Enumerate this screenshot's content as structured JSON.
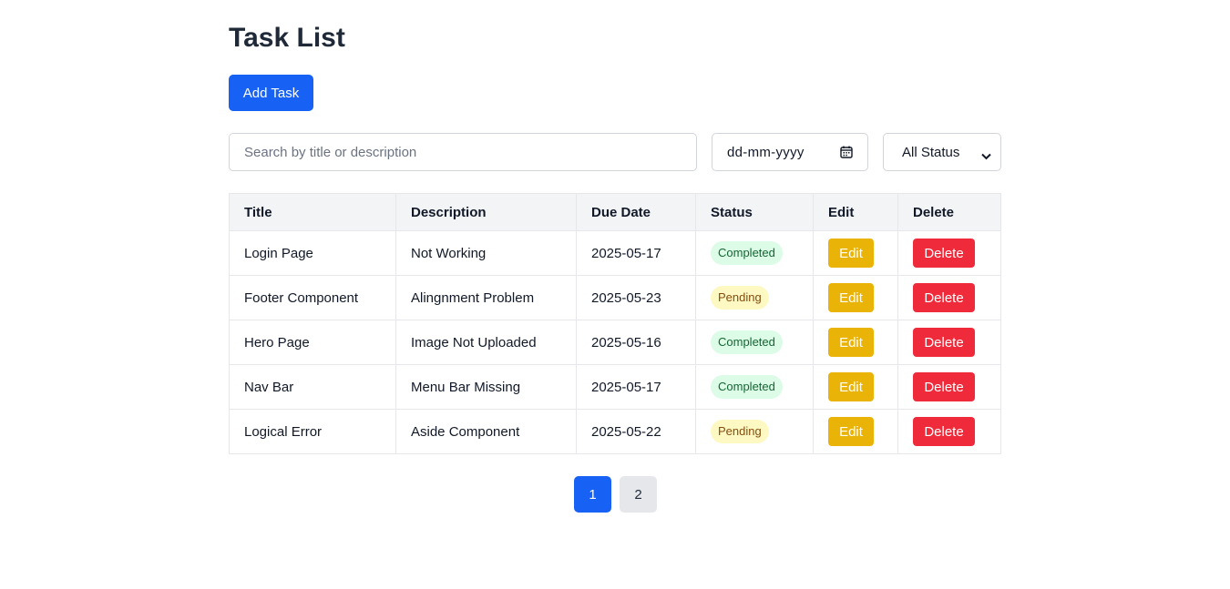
{
  "page": {
    "title": "Task List",
    "add_button_label": "Add Task"
  },
  "filters": {
    "search_placeholder": "Search by title or description",
    "date_placeholder": "dd-mm-yyyy",
    "date_icon": "calendar-icon",
    "status_selected": "All Status",
    "status_icon": "chevron-down-icon"
  },
  "table": {
    "headers": [
      "Title",
      "Description",
      "Due Date",
      "Status",
      "Edit",
      "Delete"
    ],
    "rows": [
      {
        "title": "Login Page",
        "description": "Not Working",
        "due_date": "2025-05-17",
        "status": "Completed",
        "edit": "Edit",
        "delete": "Delete"
      },
      {
        "title": "Footer Component",
        "description": "Alingnment Problem",
        "due_date": "2025-05-23",
        "status": "Pending",
        "edit": "Edit",
        "delete": "Delete"
      },
      {
        "title": "Hero Page",
        "description": "Image Not Uploaded",
        "due_date": "2025-05-16",
        "status": "Completed",
        "edit": "Edit",
        "delete": "Delete"
      },
      {
        "title": "Nav Bar",
        "description": "Menu Bar Missing",
        "due_date": "2025-05-17",
        "status": "Completed",
        "edit": "Edit",
        "delete": "Delete"
      },
      {
        "title": "Logical Error",
        "description": "Aside Component",
        "due_date": "2025-05-22",
        "status": "Pending",
        "edit": "Edit",
        "delete": "Delete"
      }
    ]
  },
  "pagination": {
    "pages": [
      "1",
      "2"
    ],
    "active": "1"
  },
  "colors": {
    "primary": "#1762f5",
    "edit": "#eab308",
    "delete": "#ef2a3a",
    "completed_bg": "#dcfce7",
    "pending_bg": "#fef9c3"
  }
}
